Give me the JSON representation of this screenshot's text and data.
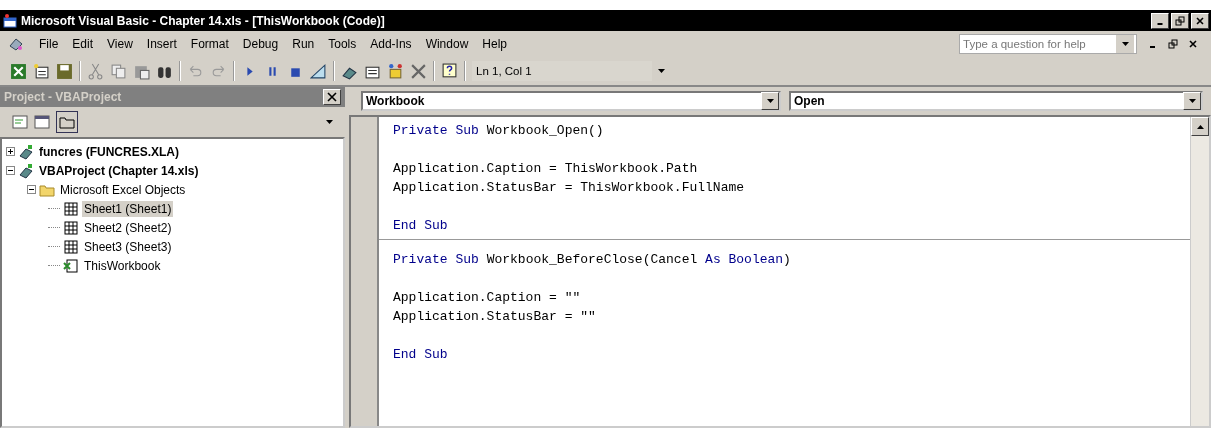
{
  "window": {
    "title": "Microsoft Visual Basic - Chapter 14.xls - [ThisWorkbook (Code)]"
  },
  "menu": [
    "File",
    "Edit",
    "View",
    "Insert",
    "Format",
    "Debug",
    "Run",
    "Tools",
    "Add-Ins",
    "Window",
    "Help"
  ],
  "help_search": {
    "placeholder": "Type a question for help"
  },
  "toolbar": {
    "position": "Ln 1, Col 1"
  },
  "project_panel": {
    "title": "Project - VBAProject",
    "tree": [
      {
        "label": "funcres (FUNCRES.XLA)",
        "kind": "project",
        "expanded": false,
        "selected": false
      },
      {
        "label": "VBAProject (Chapter 14.xls)",
        "kind": "project",
        "expanded": true,
        "selected": false,
        "children": [
          {
            "label": "Microsoft Excel Objects",
            "kind": "folder",
            "expanded": true,
            "selected": false,
            "children": [
              {
                "label": "Sheet1 (Sheet1)",
                "kind": "sheet",
                "selected": true
              },
              {
                "label": "Sheet2 (Sheet2)",
                "kind": "sheet",
                "selected": false
              },
              {
                "label": "Sheet3 (Sheet3)",
                "kind": "sheet",
                "selected": false
              },
              {
                "label": "ThisWorkbook",
                "kind": "workbook",
                "selected": false
              }
            ]
          }
        ]
      }
    ]
  },
  "code_window": {
    "object": "Workbook",
    "procedure": "Open",
    "procedures": [
      {
        "signature": [
          {
            "text": "Private Sub",
            "kind": "keyword"
          },
          {
            "text": " Workbook_Open()",
            "kind": "plain"
          }
        ],
        "body": [
          "Application.Caption = ThisWorkbook.Path",
          "Application.StatusBar = ThisWorkbook.FullName"
        ],
        "end": [
          {
            "text": "End Sub",
            "kind": "keyword"
          }
        ]
      },
      {
        "signature": [
          {
            "text": "Private Sub",
            "kind": "keyword"
          },
          {
            "text": " Workbook_BeforeClose(Cancel ",
            "kind": "plain"
          },
          {
            "text": "As Boolean",
            "kind": "keyword"
          },
          {
            "text": ")",
            "kind": "plain"
          }
        ],
        "body": [
          "Application.Caption = \"\"",
          "Application.StatusBar = \"\""
        ],
        "end": [
          {
            "text": "End Sub",
            "kind": "keyword"
          }
        ]
      }
    ]
  }
}
